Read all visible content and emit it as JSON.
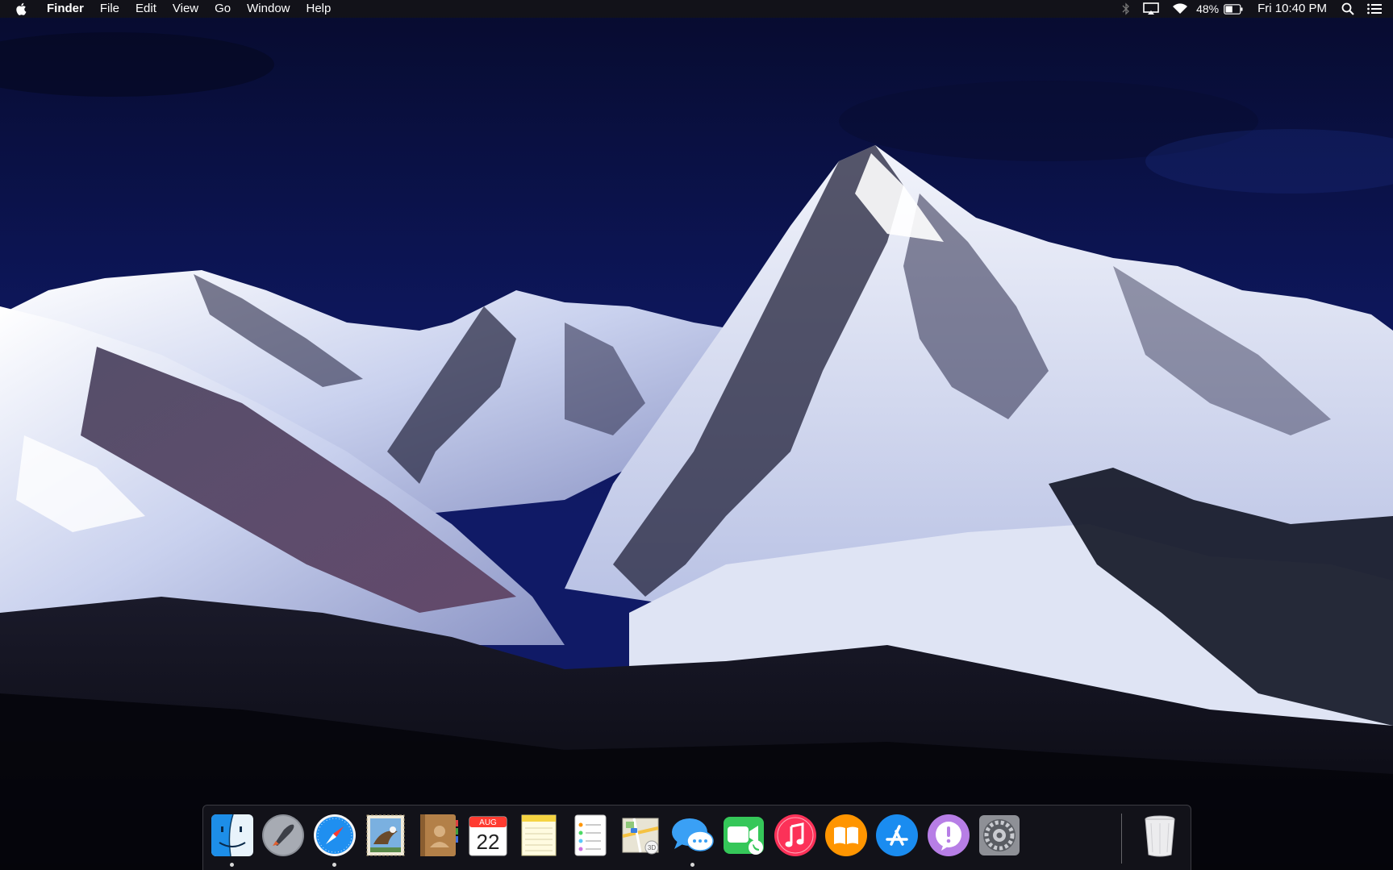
{
  "menubar": {
    "app_name": "Finder",
    "menus": [
      "File",
      "Edit",
      "View",
      "Go",
      "Window",
      "Help"
    ],
    "battery_percent": "48%",
    "clock": "Fri 10:40 PM",
    "status_icons": [
      "bluetooth-icon",
      "airplay-icon",
      "wifi-icon",
      "battery-icon",
      "spotlight-icon",
      "notification-center-icon"
    ]
  },
  "wallpaper": {
    "description_colors": {
      "sky": "#0b1450",
      "snow": "#e8ecf6",
      "forest": "#0d0f1c",
      "rock": "#2a2438"
    }
  },
  "dock": {
    "items": [
      {
        "name": "Finder",
        "icon": "finder-icon",
        "running": true
      },
      {
        "name": "Launchpad",
        "icon": "launchpad-icon",
        "running": false
      },
      {
        "name": "Safari",
        "icon": "safari-icon",
        "running": true
      },
      {
        "name": "Mail",
        "icon": "mail-icon",
        "running": false
      },
      {
        "name": "Contacts",
        "icon": "contacts-icon",
        "running": false
      },
      {
        "name": "Calendar",
        "icon": "calendar-icon",
        "running": false,
        "month": "AUG",
        "day": "22"
      },
      {
        "name": "Notes",
        "icon": "notes-icon",
        "running": false
      },
      {
        "name": "Reminders",
        "icon": "reminders-icon",
        "running": false
      },
      {
        "name": "Maps",
        "icon": "maps-icon",
        "running": false
      },
      {
        "name": "Messages",
        "icon": "messages-icon",
        "running": true
      },
      {
        "name": "FaceTime",
        "icon": "facetime-icon",
        "running": false
      },
      {
        "name": "iTunes",
        "icon": "itunes-icon",
        "running": false
      },
      {
        "name": "iBooks",
        "icon": "ibooks-icon",
        "running": false
      },
      {
        "name": "App Store",
        "icon": "app-store-icon",
        "running": false
      },
      {
        "name": "Feedback Assistant",
        "icon": "feedback-icon",
        "running": false
      },
      {
        "name": "System Preferences",
        "icon": "system-preferences-icon",
        "running": false
      },
      {
        "name": "Trash",
        "icon": "trash-icon",
        "running": false
      }
    ]
  }
}
